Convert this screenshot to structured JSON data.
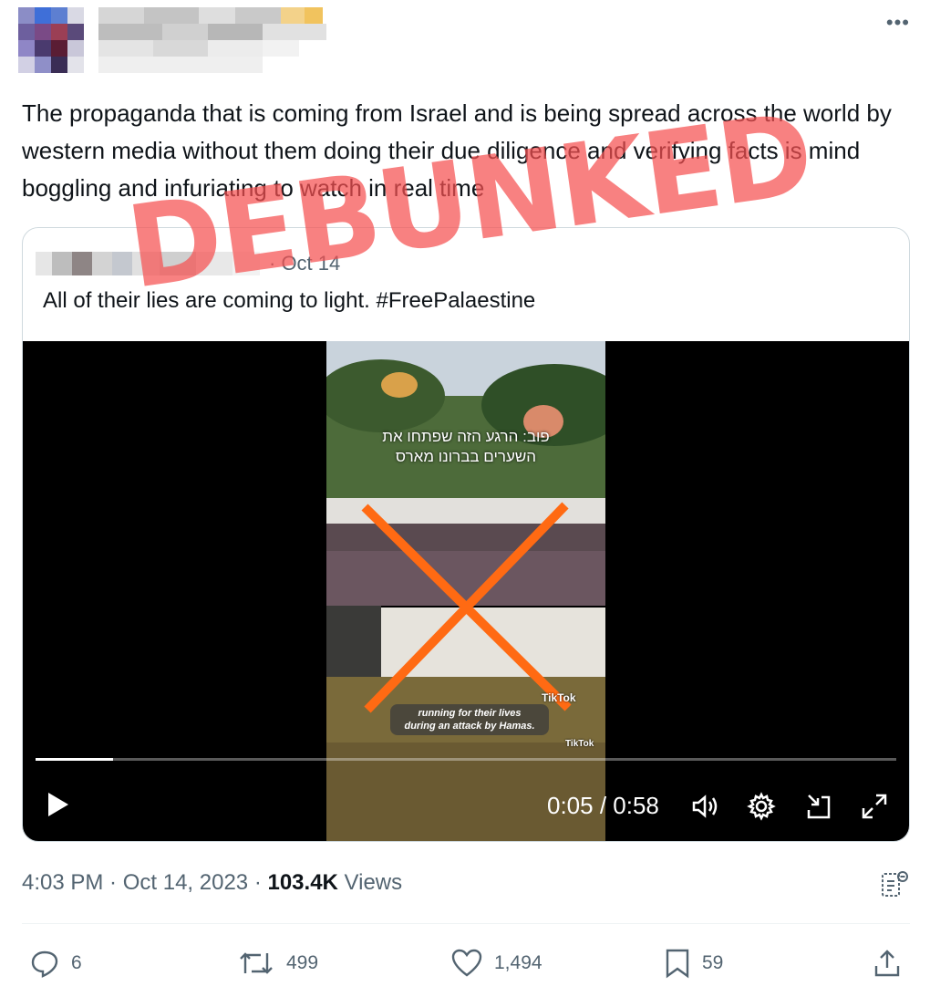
{
  "tweet": {
    "text": "The propaganda that is coming from Israel and is being spread across the world by western media without them doing their due diligence and verifying facts is mind boggling and infuriating to watch in real time",
    "more_icon": "more-horizontal-icon",
    "stamp": "DEBUNKED",
    "time": "4:03 PM",
    "date": "Oct 14, 2023",
    "views_count": "103.4K",
    "views_label": "Views"
  },
  "quote": {
    "date": "· Oct 14",
    "text": "All of their lies are coming to light. #FreePalaestine",
    "video": {
      "caption_he_line1": "פוב: הרגע הזה שפתחו את",
      "caption_he_line2": "השערים בברונו מארס",
      "caption_en_line1": "running for their lives",
      "caption_en_line2": "during an attack by Hamas.",
      "watermark": "TikTok",
      "current_time": "0:05",
      "duration": "0:58",
      "progress": 0.09
    }
  },
  "actions": {
    "replies": "6",
    "reposts": "499",
    "likes": "1,494",
    "bookmarks": "59"
  },
  "colors": {
    "text_primary": "#0f1419",
    "text_secondary": "#536471",
    "border": "#cfd9de",
    "stamp": "#f55050",
    "cross": "#ff6a13"
  }
}
